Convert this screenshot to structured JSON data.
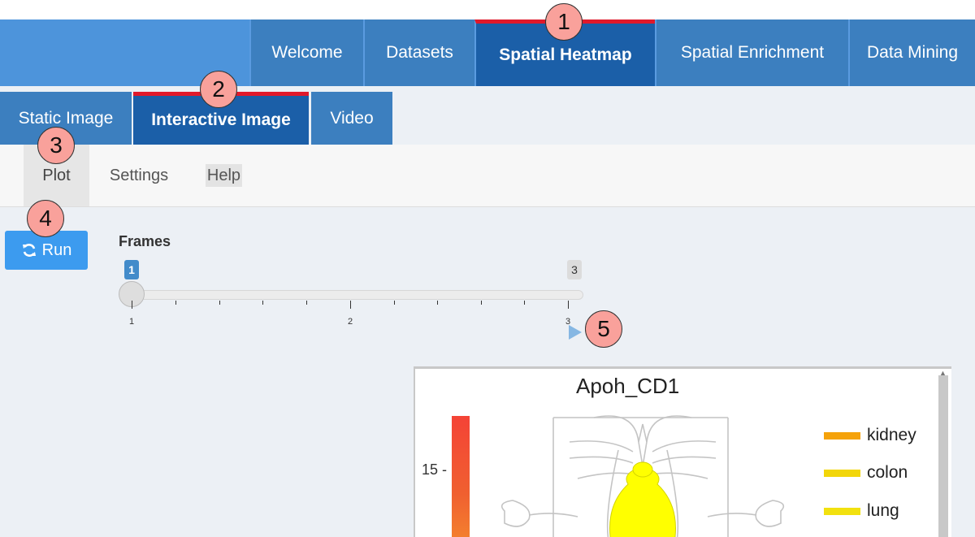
{
  "top_tabs": [
    {
      "label": "Welcome",
      "active": false
    },
    {
      "label": "Datasets",
      "active": false
    },
    {
      "label": "Spatial Heatmap",
      "active": true
    },
    {
      "label": "Spatial Enrichment",
      "active": false
    },
    {
      "label": "Data Mining",
      "active": false
    }
  ],
  "sub_tabs": [
    {
      "label": "Static Image",
      "active": false
    },
    {
      "label": "Interactive Image",
      "active": true
    },
    {
      "label": "Video",
      "active": false
    }
  ],
  "inner_tabs": [
    {
      "label": "Plot",
      "active": true
    },
    {
      "label": "Settings",
      "active": false
    },
    {
      "label": "Help",
      "active": false
    }
  ],
  "run_button": {
    "label": "Run",
    "icon": "refresh-icon"
  },
  "frames_slider": {
    "label": "Frames",
    "min": "1",
    "max": "3",
    "value": "1",
    "tick_labels": [
      "1",
      "2",
      "3"
    ]
  },
  "plot": {
    "title": "Apoh_CD1",
    "colorbar_tick": "15",
    "legend": [
      {
        "label": "kidney",
        "color": "#f5a20a"
      },
      {
        "label": "colon",
        "color": "#f2d60a"
      },
      {
        "label": "lung",
        "color": "#f2e10f"
      }
    ],
    "organ_fill": "#ffff00"
  },
  "annotations": [
    "1",
    "2",
    "3",
    "4",
    "5"
  ],
  "colors": {
    "brand": "#4d94db",
    "tab": "#3c7fbf",
    "tab_active": "#1b5fa8",
    "active_marker": "#e0192b",
    "run_button": "#3c9bef"
  }
}
